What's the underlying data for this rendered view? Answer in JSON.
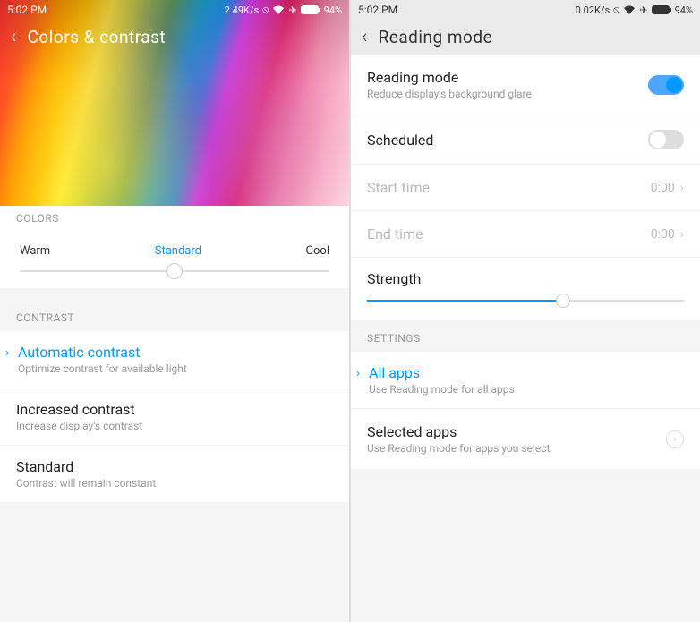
{
  "left": {
    "status": {
      "time": "5:02 PM",
      "speed": "2.49K/s",
      "battery": "94%"
    },
    "title": "Colors & contrast",
    "colors": {
      "header": "COLORS",
      "warm": "Warm",
      "standard": "Standard",
      "cool": "Cool",
      "position_pct": 50
    },
    "contrast": {
      "header": "CONTRAST",
      "items": [
        {
          "label": "Automatic contrast",
          "sub": "Optimize contrast for available light",
          "selected": true
        },
        {
          "label": "Increased contrast",
          "sub": "Increase display's contrast",
          "selected": false
        },
        {
          "label": "Standard",
          "sub": "Contrast will remain constant",
          "selected": false
        }
      ]
    }
  },
  "right": {
    "status": {
      "time": "5:02 PM",
      "speed": "0.02K/s",
      "battery": "94%"
    },
    "title": "Reading mode",
    "reading_mode": {
      "label": "Reading mode",
      "sub": "Reduce display's background glare",
      "on": true
    },
    "scheduled": {
      "label": "Scheduled",
      "on": false
    },
    "start_time": {
      "label": "Start time",
      "value": "0:00"
    },
    "end_time": {
      "label": "End time",
      "value": "0:00"
    },
    "strength": {
      "label": "Strength",
      "position_pct": 62
    },
    "settings_header": "SETTINGS",
    "all_apps": {
      "label": "All apps",
      "sub": "Use Reading mode for all apps",
      "selected": true
    },
    "selected_apps": {
      "label": "Selected apps",
      "sub": "Use Reading mode for apps you select",
      "selected": false
    }
  }
}
